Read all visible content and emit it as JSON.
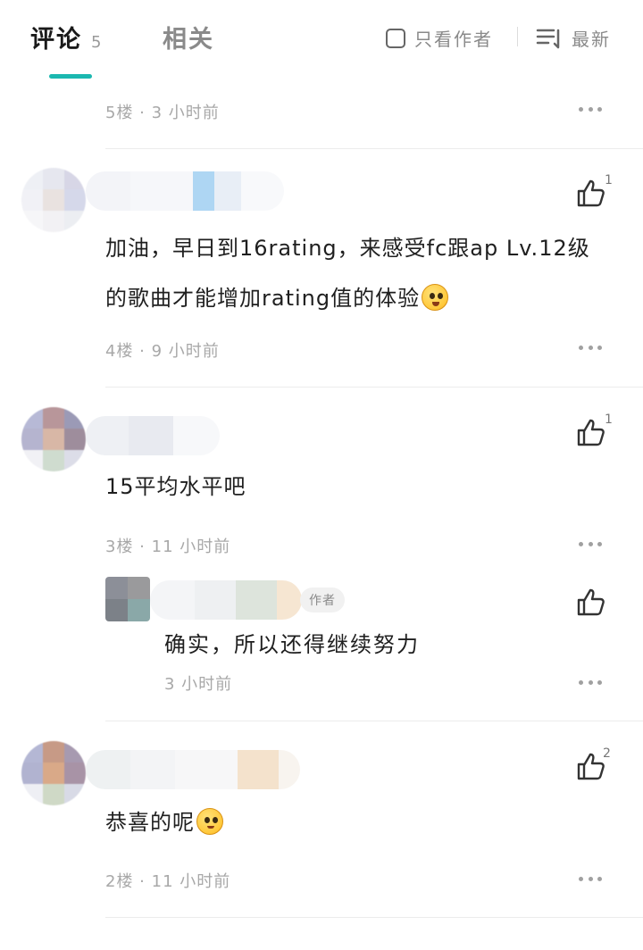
{
  "tabs": {
    "comments_label": "评论",
    "comments_count": "5",
    "related_label": "相关"
  },
  "filters": {
    "author_only_label": "只看作者",
    "sort_label": "最新"
  },
  "colors": {
    "accent": "#1bb8b0"
  },
  "icons": {
    "more": "more-dots-icon",
    "like": "thumbs-up-icon",
    "sort": "sort-lines-icon",
    "checkbox": "checkbox-icon"
  },
  "comments": [
    {
      "meta": "5楼 · 3 小时前"
    },
    {
      "text_line1": "加油，早日到16rating，来感受fc跟ap Lv.12级",
      "text_line2": "的歌曲才能增加rating值的体验",
      "likes": "1",
      "meta": "4楼 · 9 小时前"
    },
    {
      "text": "15平均水平吧",
      "likes": "1",
      "meta": "3楼 · 11 小时前",
      "reply": {
        "author_tag": "作者",
        "text": "确实，所以还得继续努力",
        "time": "3 小时前"
      }
    },
    {
      "text": "恭喜的呢",
      "likes": "2",
      "meta": "2楼 · 11 小时前"
    }
  ]
}
